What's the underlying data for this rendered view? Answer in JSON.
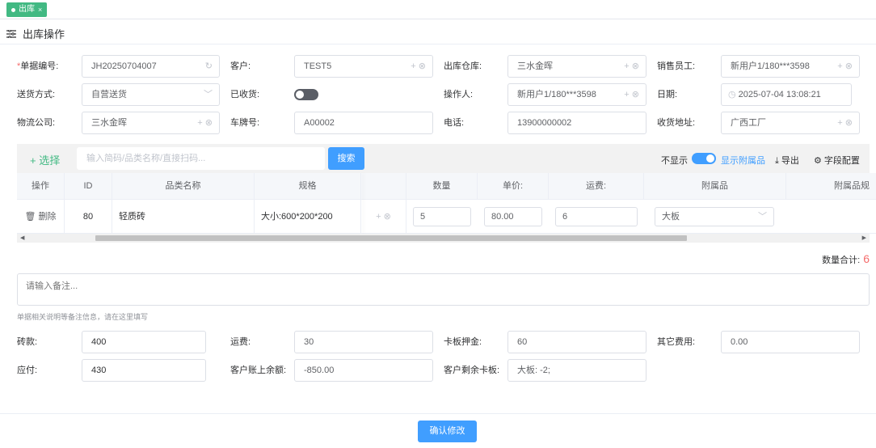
{
  "tab": {
    "label": "出库"
  },
  "page": {
    "title": "出库操作"
  },
  "form": {
    "order_no": {
      "label": "单据编号:",
      "value": "JH20250704007"
    },
    "customer": {
      "label": "客户:",
      "value": "TEST5"
    },
    "warehouse": {
      "label": "出库仓库:",
      "value": "三水金晖"
    },
    "salesperson": {
      "label": "销售员工:",
      "value": "新用户1/180***3598"
    },
    "delivery": {
      "label": "送货方式:",
      "value": "自营送货"
    },
    "received": {
      "label": "已收货:",
      "on": false
    },
    "operator": {
      "label": "操作人:",
      "value": "新用户1/180***3598"
    },
    "date": {
      "label": "日期:",
      "value": "2025-07-04 13:08:21"
    },
    "logistics": {
      "label": "物流公司:",
      "value": "三水金晖"
    },
    "plate": {
      "label": "车牌号:",
      "value": "A00002"
    },
    "phone": {
      "label": "电话:",
      "value": "13900000002"
    },
    "address": {
      "label": "收货地址:",
      "value": "广西工厂"
    }
  },
  "toolbar": {
    "select_label": "+ 选择",
    "search_placeholder": "输入简码/品类名称/直接扫码...",
    "search_button": "搜索",
    "hide_label": "不显示",
    "show_label": "显示附属品",
    "export_label": "导出",
    "field_config_label": "字段配置"
  },
  "table": {
    "headers": [
      "操作",
      "ID",
      "品类名称",
      "规格",
      "数量",
      "单价:",
      "运费:",
      "附属品",
      "附属品规"
    ],
    "row": {
      "action": "删除",
      "id": "80",
      "name": "轻质砖",
      "spec": "大小:600*200*200",
      "qty": "5",
      "price": "80.00",
      "freight": "6",
      "accessory": "大板"
    }
  },
  "total": {
    "label": "数量合计:",
    "value": "6"
  },
  "note": {
    "placeholder": "请输入备注...",
    "hint": "单据相关说明等备注信息，请在这里填写"
  },
  "fees": {
    "brick": {
      "label": "砖款:",
      "value": "400"
    },
    "freight": {
      "label": "运费:",
      "value": "30"
    },
    "pallet_deposit": {
      "label": "卡板押金:",
      "value": "60"
    },
    "other": {
      "label": "其它费用:",
      "value": "0.00"
    },
    "payable": {
      "label": "应付:",
      "value": "430"
    },
    "balance": {
      "label": "客户账上余额:",
      "value": "-850.00"
    },
    "remaining_pallet": {
      "label": "客户剩余卡板:",
      "value": "大板: -2;"
    }
  },
  "confirm_button": "确认修改",
  "colors": {
    "accent": "#409eff",
    "tab": "#42b983",
    "total": "#f56c6c"
  }
}
